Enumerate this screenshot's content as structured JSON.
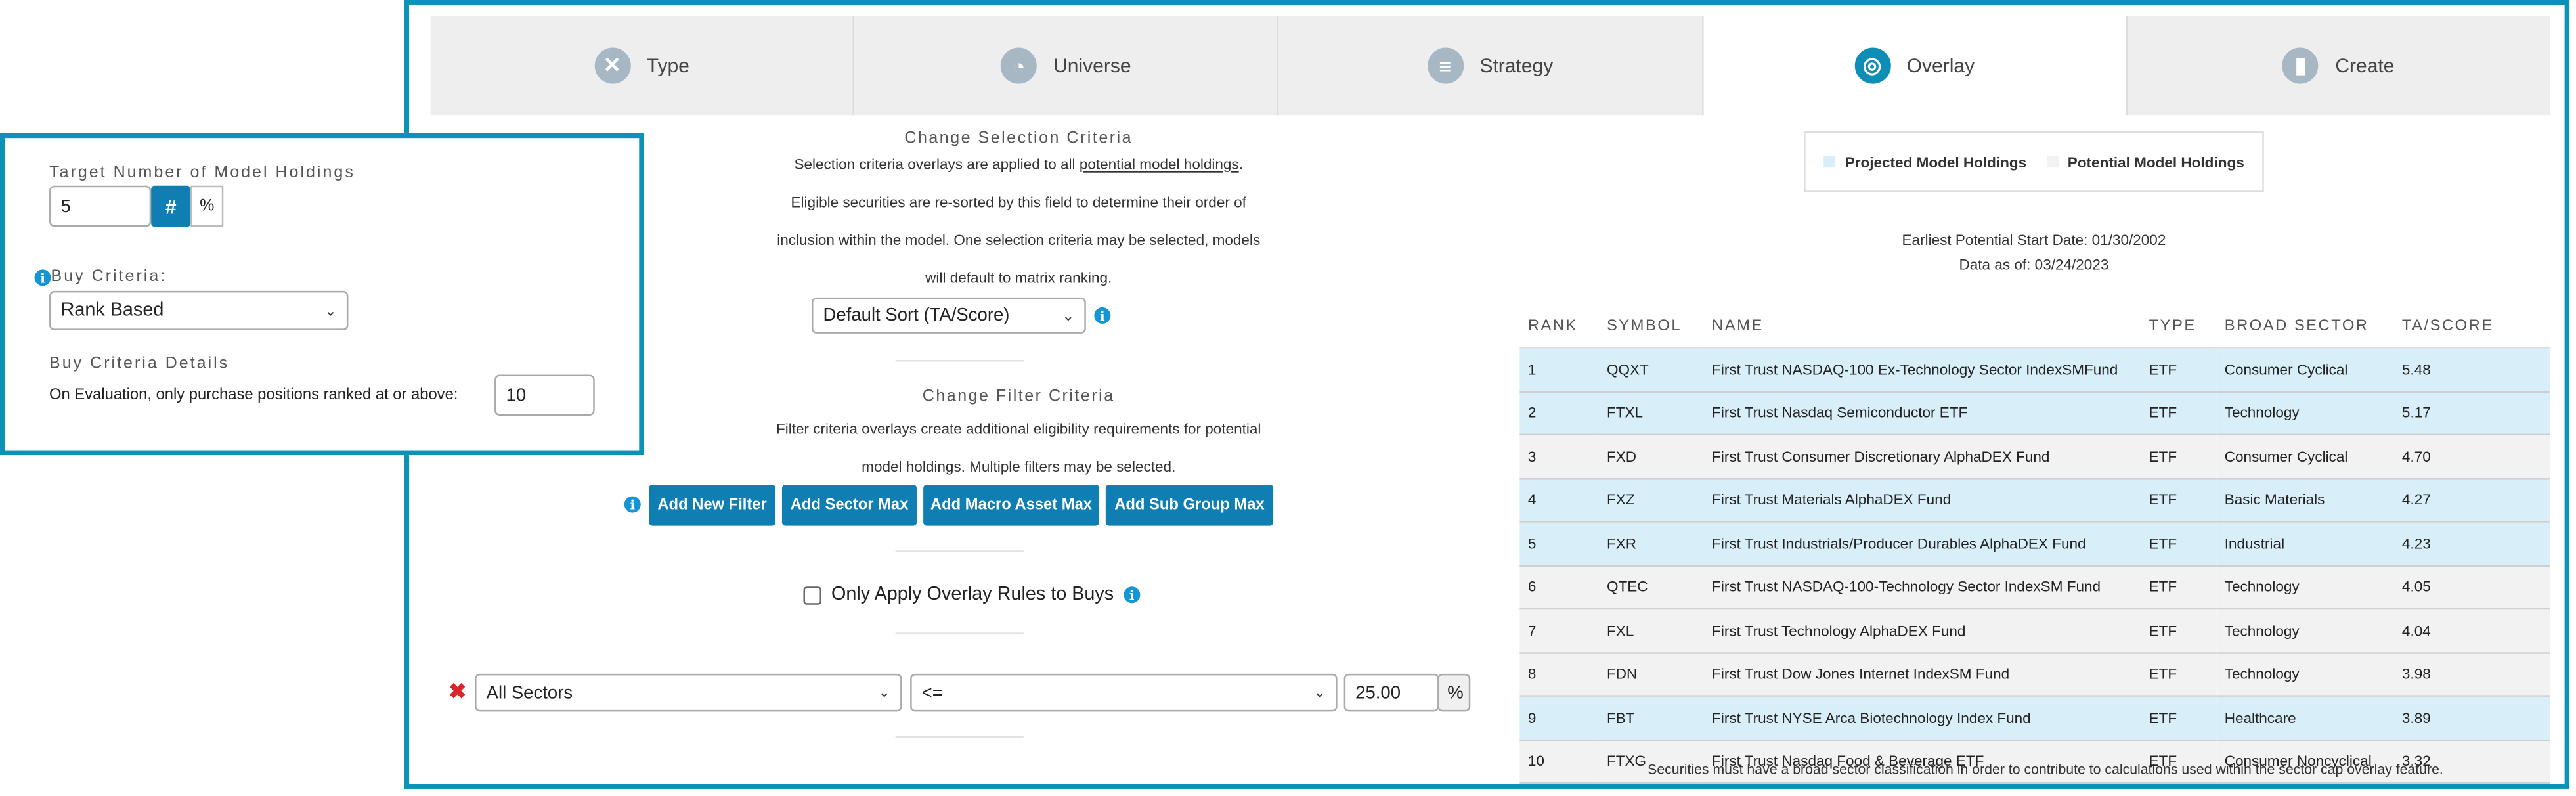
{
  "colors": {
    "accent": "#0a93b6",
    "button": "#0e7eb3",
    "projected_row": "#d8eef9",
    "potential_row": "#f2f2f2",
    "remove": "#d9262c"
  },
  "tabs": [
    {
      "label": "Type",
      "icon": "wrench-cross-icon"
    },
    {
      "label": "Universe",
      "icon": "pie-chart-icon"
    },
    {
      "label": "Strategy",
      "icon": "sliders-icon"
    },
    {
      "label": "Overlay",
      "icon": "target-icon",
      "active": true
    },
    {
      "label": "Create",
      "icon": "bar-chart-icon"
    }
  ],
  "popout": {
    "target_label": "Target Number of Model Holdings",
    "target_value": "5",
    "hash_label": "#",
    "percent_label": "%",
    "buy_criteria_label": "Buy Criteria:",
    "buy_criteria_value": "Rank Based",
    "details_label": "Buy Criteria Details",
    "details_text": "On Evaluation, only purchase positions ranked at or above:",
    "details_value": "10"
  },
  "selection": {
    "title": "Change Selection Criteria",
    "line1_pre": "Selection criteria overlays are applied to all ",
    "line1_link": "potential model holdings",
    "line1_post": ".",
    "line2": "Eligible securities are re-sorted by this field to determine their order of",
    "line3": "inclusion within the model. One selection criteria may be selected, models",
    "line4": "will default to matrix ranking.",
    "sort_value": "Default Sort (TA/Score)"
  },
  "filter": {
    "title": "Change Filter Criteria",
    "line1": "Filter criteria overlays create additional eligibility requirements for potential",
    "line2": "model holdings. Multiple filters may be selected.",
    "buttons": [
      "Add New Filter",
      "Add Sector Max",
      "Add Macro Asset Max",
      "Add Sub Group Max"
    ],
    "only_buys_label": "Only Apply Overlay Rules to Buys",
    "row": {
      "sector": "All Sectors",
      "operator": "<=",
      "value": "25.00",
      "unit": "%"
    }
  },
  "legend": {
    "projected": "Projected Model Holdings",
    "potential": "Potential Model Holdings"
  },
  "dates": {
    "start": "Earliest Potential Start Date: 01/30/2002",
    "asof": "Data as of: 03/24/2023"
  },
  "table": {
    "headers": [
      "RANK",
      "SYMBOL",
      "NAME",
      "TYPE",
      "BROAD SECTOR",
      "TA/SCORE"
    ],
    "rows": [
      {
        "rank": "1",
        "symbol": "QQXT",
        "name": "First Trust NASDAQ-100 Ex-Technology Sector IndexSMFund",
        "type": "ETF",
        "sector": "Consumer Cyclical",
        "score": "5.48",
        "status": "projected"
      },
      {
        "rank": "2",
        "symbol": "FTXL",
        "name": "First Trust Nasdaq Semiconductor ETF",
        "type": "ETF",
        "sector": "Technology",
        "score": "5.17",
        "status": "projected"
      },
      {
        "rank": "3",
        "symbol": "FXD",
        "name": "First Trust Consumer Discretionary AlphaDEX Fund",
        "type": "ETF",
        "sector": "Consumer Cyclical",
        "score": "4.70",
        "status": "potential"
      },
      {
        "rank": "4",
        "symbol": "FXZ",
        "name": "First Trust Materials AlphaDEX Fund",
        "type": "ETF",
        "sector": "Basic Materials",
        "score": "4.27",
        "status": "projected"
      },
      {
        "rank": "5",
        "symbol": "FXR",
        "name": "First Trust Industrials/Producer Durables AlphaDEX Fund",
        "type": "ETF",
        "sector": "Industrial",
        "score": "4.23",
        "status": "projected"
      },
      {
        "rank": "6",
        "symbol": "QTEC",
        "name": "First Trust NASDAQ-100-Technology Sector IndexSM Fund",
        "type": "ETF",
        "sector": "Technology",
        "score": "4.05",
        "status": "potential"
      },
      {
        "rank": "7",
        "symbol": "FXL",
        "name": "First Trust Technology AlphaDEX Fund",
        "type": "ETF",
        "sector": "Technology",
        "score": "4.04",
        "status": "potential"
      },
      {
        "rank": "8",
        "symbol": "FDN",
        "name": "First Trust Dow Jones Internet IndexSM Fund",
        "type": "ETF",
        "sector": "Technology",
        "score": "3.98",
        "status": "potential"
      },
      {
        "rank": "9",
        "symbol": "FBT",
        "name": "First Trust NYSE Arca Biotechnology Index Fund",
        "type": "ETF",
        "sector": "Healthcare",
        "score": "3.89",
        "status": "projected"
      },
      {
        "rank": "10",
        "symbol": "FTXG",
        "name": "First Trust Nasdaq Food & Beverage ETF",
        "type": "ETF",
        "sector": "Consumer Noncyclical",
        "score": "3.32",
        "status": "potential"
      }
    ]
  },
  "footnote": "Securities must have a broad sector classification in order to contribute to calculations used within the sector cap overlay feature."
}
